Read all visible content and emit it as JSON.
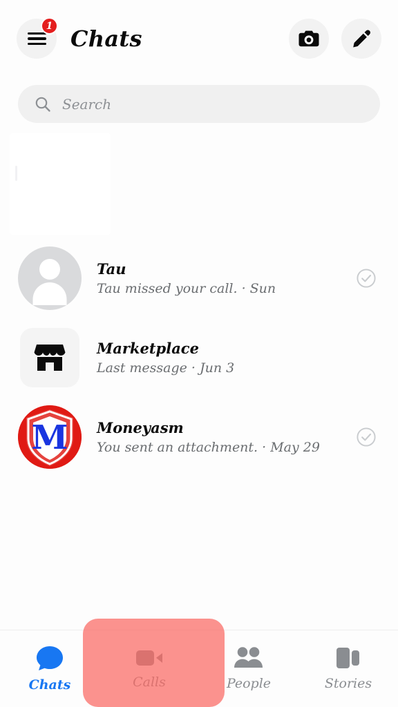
{
  "header": {
    "title": "Chats",
    "menu_icon": "hamburger-menu-icon",
    "menu_badge": "1",
    "camera_icon": "camera-icon",
    "compose_icon": "pencil-compose-icon"
  },
  "search": {
    "placeholder": "Search",
    "value": "",
    "icon": "search-icon"
  },
  "chats": [
    {
      "name": "Tau",
      "snippet": "Tau missed your call. · Sun",
      "avatar_type": "default-person",
      "avatar_icon": "person-avatar-icon",
      "status_icon": "check-circle-icon",
      "has_status": true
    },
    {
      "name": "Marketplace",
      "snippet": "Last message · Jun 3",
      "avatar_type": "marketplace",
      "avatar_icon": "storefront-icon",
      "status_icon": "",
      "has_status": false
    },
    {
      "name": "Moneyasm",
      "snippet": "You sent an attachment. · May 29",
      "avatar_type": "logo-shield-m",
      "avatar_icon": "shield-logo-icon",
      "status_icon": "check-circle-icon",
      "has_status": true
    }
  ],
  "bottom_nav": {
    "items": [
      {
        "label": "Chats",
        "icon": "chat-bubble-icon",
        "active": true
      },
      {
        "label": "Calls",
        "icon": "video-camera-icon",
        "active": false
      },
      {
        "label": "People",
        "icon": "people-icon",
        "active": false
      },
      {
        "label": "Stories",
        "icon": "stories-cards-icon",
        "active": false
      }
    ]
  },
  "colors": {
    "accent_blue": "#1877f2",
    "badge_red": "#e41e1e",
    "tap_highlight": "#f96863",
    "logo_red": "#e01a14",
    "logo_blue": "#1a35e0",
    "muted_text": "#8a8d91"
  }
}
